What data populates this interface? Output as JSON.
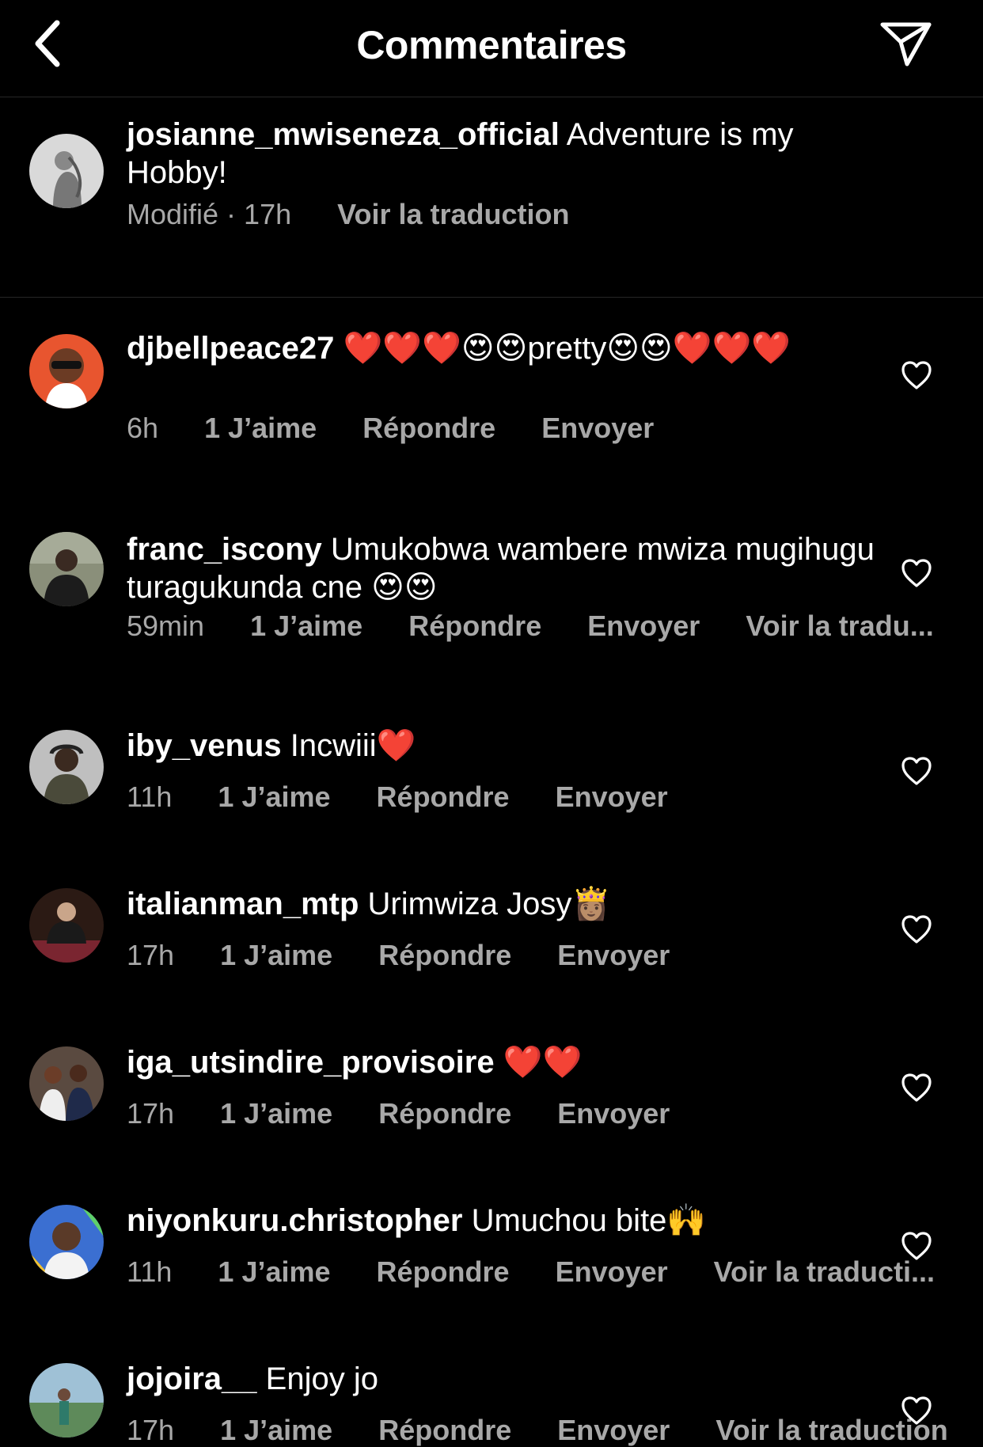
{
  "header": {
    "title": "Commentaires"
  },
  "caption": {
    "username": "josianne_mwiseneza_official",
    "text": "Adventure is my Hobby!",
    "edited_time": "Modifié · 17h",
    "translate_label": "Voir la traduction"
  },
  "comments": [
    {
      "username": "djbellpeace27",
      "text": "❤️❤️❤️😍😍pretty😍😍❤️❤️❤️",
      "time": "6h",
      "likes": "1 J’aime",
      "reply": "Répondre",
      "send": "Envoyer"
    },
    {
      "username": "franc_iscony",
      "text": "Umukobwa wambere mwiza mugihugu turagukunda cne 😍😍",
      "time": "59min",
      "likes": "1 J’aime",
      "reply": "Répondre",
      "send": "Envoyer",
      "translate": "Voir la tradu..."
    },
    {
      "username": "iby_venus",
      "text": "Incwiii❤️",
      "time": "11h",
      "likes": "1 J’aime",
      "reply": "Répondre",
      "send": "Envoyer"
    },
    {
      "username": "italianman_mtp",
      "text": "Urimwiza Josy👸🏽",
      "time": "17h",
      "likes": "1 J’aime",
      "reply": "Répondre",
      "send": "Envoyer"
    },
    {
      "username": "iga_utsindire_provisoire",
      "text": "❤️❤️",
      "time": "17h",
      "likes": "1 J’aime",
      "reply": "Répondre",
      "send": "Envoyer"
    },
    {
      "username": "niyonkuru.christopher",
      "text": "Umuchou bite🙌",
      "time": "11h",
      "likes": "1 J’aime",
      "reply": "Répondre",
      "send": "Envoyer",
      "translate": "Voir la traducti..."
    },
    {
      "username": "jojoira__",
      "text": "Enjoy jo",
      "time": "17h",
      "likes": "1 J’aime",
      "reply": "Répondre",
      "send": "Envoyer",
      "translate": "Voir la traduction"
    }
  ],
  "icons": {
    "back": "chevron-left-icon",
    "share": "paper-plane-icon",
    "like": "heart-outline-icon"
  },
  "colors": {
    "background": "#000000",
    "text": "#ffffff",
    "secondary": "#a8a8a8",
    "divider": "#262626"
  }
}
